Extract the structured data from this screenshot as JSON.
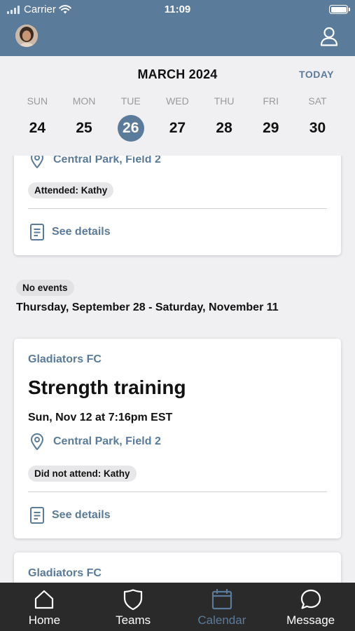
{
  "status_bar": {
    "carrier": "Carrier",
    "time": "11:09"
  },
  "calendar": {
    "month": "MARCH 2024",
    "today_label": "TODAY",
    "weekdays": [
      "SUN",
      "MON",
      "TUE",
      "WED",
      "THU",
      "FRI",
      "SAT"
    ],
    "dates": [
      "24",
      "25",
      "26",
      "27",
      "28",
      "29",
      "30"
    ],
    "selected": "26"
  },
  "card_partial": {
    "location": "Central Park, Field 2",
    "attendance": "Attended: Kathy",
    "details_label": "See details"
  },
  "gap": {
    "badge": "No events",
    "range": "Thursday, September 28 - Saturday, November 11"
  },
  "card_event": {
    "team": "Gladiators FC",
    "title": "Strength training",
    "time": "Sun, Nov 12 at 7:16pm EST",
    "location": "Central Park, Field 2",
    "attendance": "Did not attend: Kathy",
    "details_label": "See details"
  },
  "card_next": {
    "team": "Gladiators FC"
  },
  "tabs": [
    {
      "label": "Home",
      "icon": "home-icon"
    },
    {
      "label": "Teams",
      "icon": "shield-icon"
    },
    {
      "label": "Calendar",
      "icon": "calendar-icon"
    },
    {
      "label": "Message",
      "icon": "chat-bubble-icon"
    }
  ],
  "colors": {
    "accent": "#5b7b9a",
    "tabbar": "#2a2a2a",
    "background": "#f0f0f2"
  }
}
